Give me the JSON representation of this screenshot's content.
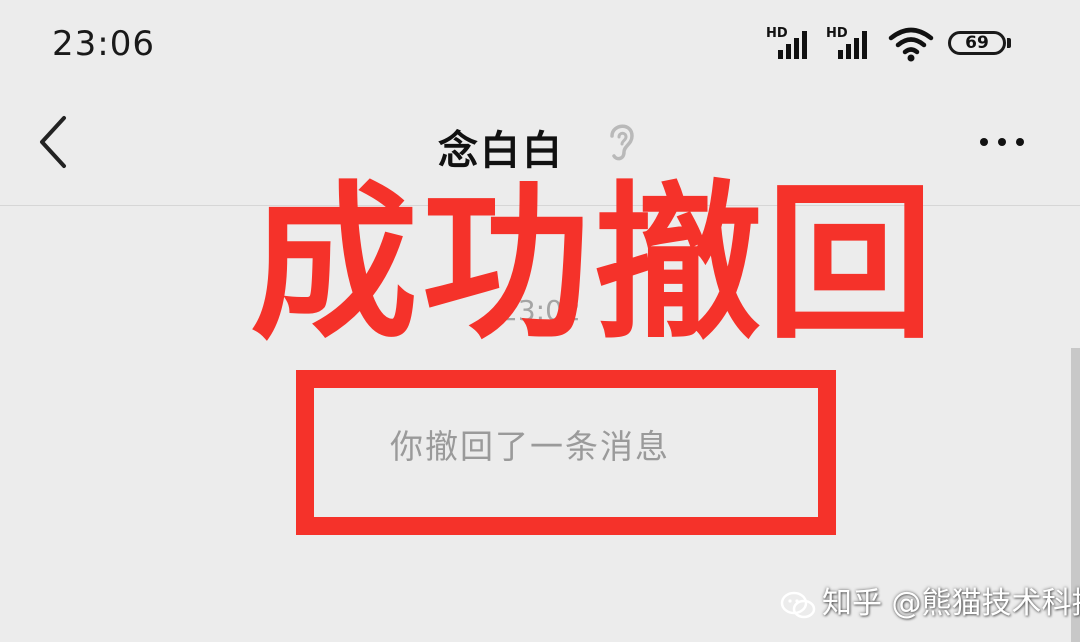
{
  "status_bar": {
    "time": "23:06",
    "signal_1_label": "HD",
    "signal_2_label": "HD",
    "wifi_icon": "wifi-icon",
    "battery_level": "69"
  },
  "header": {
    "back_icon": "chevron-left-icon",
    "title": "念白白",
    "ear_icon": "ear-icon",
    "more_icon": "more-horizontal-icon"
  },
  "chat": {
    "timestamp": "23:02",
    "recall_notice": "你撤回了一条消息"
  },
  "overlay": {
    "caption": "成功撤回",
    "color": "#f5322a"
  },
  "watermark": {
    "text": "知乎 @熊猫技术科技"
  }
}
